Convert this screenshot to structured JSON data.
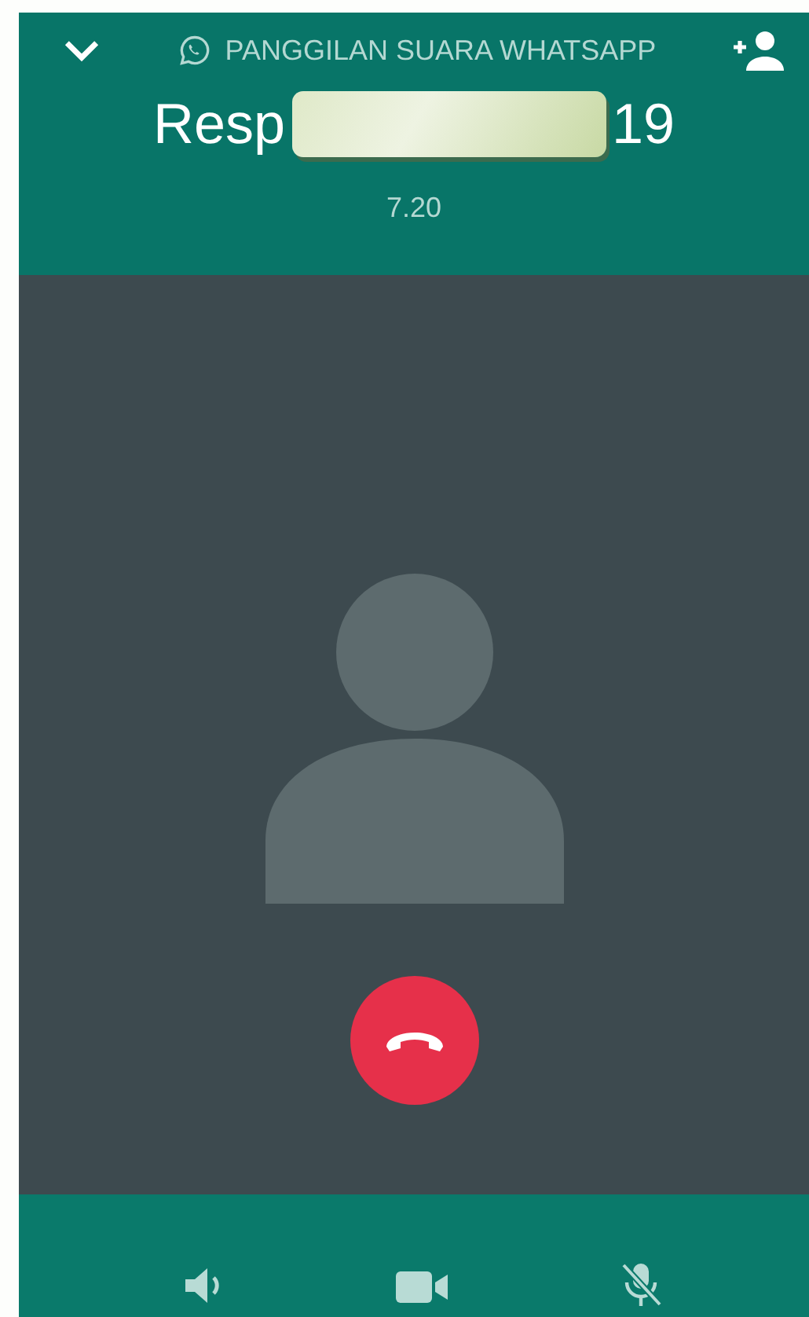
{
  "header": {
    "title": "PANGGILAN SUARA WHATSAPP",
    "name_visible_start": "Resp",
    "name_visible_end": "19",
    "name_redacted": true,
    "duration": "7.20"
  },
  "controls": {
    "mic_muted": true
  }
}
